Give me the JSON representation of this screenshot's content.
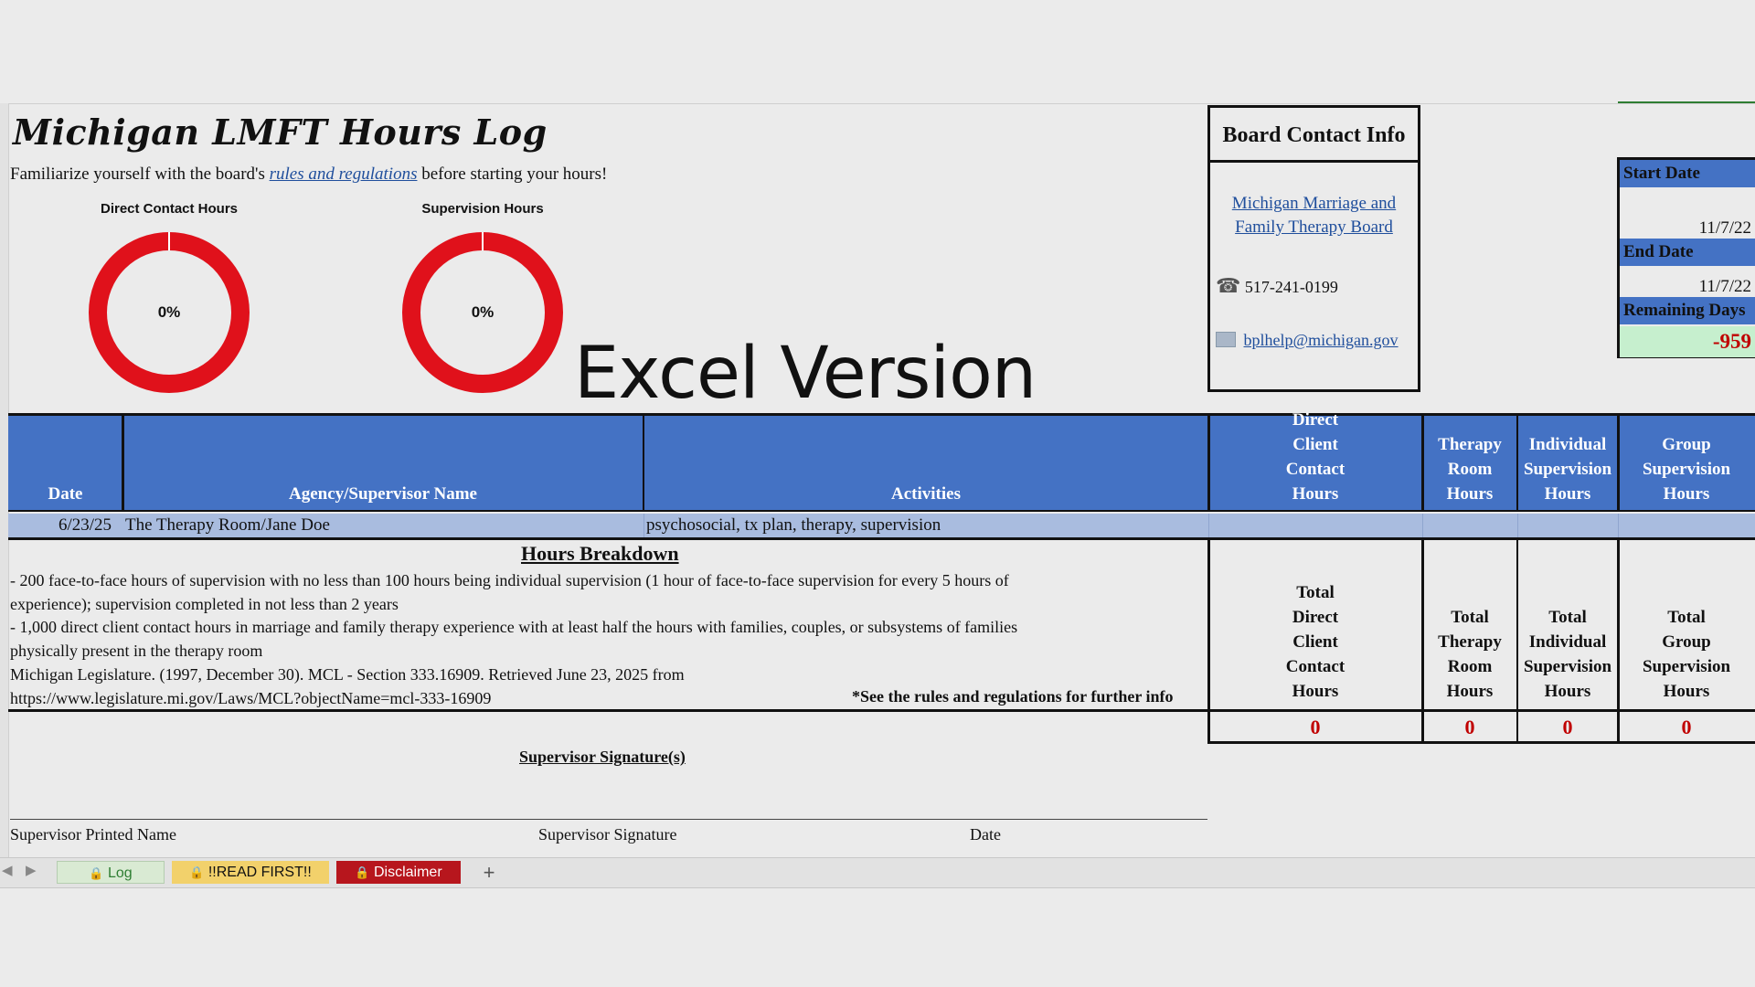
{
  "header": {
    "title": "Michigan LMFT Hours Log",
    "intro_before": "Familiarize yourself with the board's ",
    "intro_link": "rules and regulations",
    "intro_after": " before starting your hours!"
  },
  "charts": {
    "direct_label": "Direct Contact Hours",
    "direct_pct": "0%",
    "direct_value": 0,
    "supervision_label": "Supervision Hours",
    "supervision_pct": "0%",
    "supervision_value": 0,
    "ring_color": "#e0111b"
  },
  "overlay_text": "Excel Version",
  "contact": {
    "heading": "Board Contact Info",
    "board_link_line1": "Michigan Marriage and",
    "board_link_line2": "Family Therapy Board",
    "phone": "517-241-0199",
    "email": "bplhelp@michigan.gov"
  },
  "dates": {
    "start_label": "Start Date",
    "start_value": "11/7/22",
    "end_label": "End Date",
    "end_value": "11/7/22",
    "remaining_label": "Remaining Days",
    "remaining_value": "-959"
  },
  "table": {
    "headers": {
      "date": "Date",
      "agency": "Agency/Supervisor Name",
      "activities": "Activities",
      "direct": [
        "Direct",
        "Client",
        "Contact",
        "Hours"
      ],
      "therapy_room": [
        "Therapy",
        "Room",
        "Hours"
      ],
      "individual": [
        "Individual",
        "Supervision",
        "Hours"
      ],
      "group": [
        "Group",
        "Supervision",
        "Hours"
      ]
    },
    "rows": [
      {
        "date": "6/23/25",
        "agency": "The Therapy Room/Jane Doe",
        "activities": "psychosocial, tx plan, therapy, supervision",
        "direct": "",
        "therapy_room": "",
        "individual": "",
        "group": ""
      }
    ]
  },
  "breakdown": {
    "title": "Hours Breakdown",
    "line1": "- 200 face-to-face hours of supervision with no less than 100 hours being individual supervision (1 hour of face-to-face supervision for every 5 hours of",
    "line2": "experience); supervision completed in not less than 2 years",
    "line3": "- 1,000 direct client contact hours in marriage and family therapy experience with at least half the hours with families, couples, or subsystems of families",
    "line4": "physically present in the therapy room",
    "line5": "Michigan Legislature. (1997, December 30). MCL - Section 333.16909. Retrieved June 23, 2025 from",
    "line6": "https://www.legislature.mi.gov/Laws/MCL?objectName=mcl-333-16909",
    "see_note": "*See the rules and regulations for further info"
  },
  "totals": {
    "direct_label": [
      "Total",
      "Direct",
      "Client",
      "Contact",
      "Hours"
    ],
    "therapy_label": [
      "Total",
      "Therapy",
      "Room",
      "Hours"
    ],
    "individual_label": [
      "Total",
      "Individual",
      "Supervision",
      "Hours"
    ],
    "group_label": [
      "Total",
      "Group",
      "Supervision",
      "Hours"
    ],
    "direct_value": "0",
    "therapy_value": "0",
    "individual_value": "0",
    "group_value": "0"
  },
  "signature": {
    "title": "Supervisor Signature(s)",
    "printed_name": "Supervisor Printed Name",
    "signature": "Supervisor Signature",
    "date": "Date"
  },
  "tabs": [
    {
      "label": "Log",
      "bg": "#d9ead3",
      "color": "#2e7d32"
    },
    {
      "label": "!!READ FIRST!!",
      "bg": "#f2d16b",
      "color": "#111111"
    },
    {
      "label": "Disclaimer",
      "bg": "#b7161d",
      "color": "#ffffff"
    }
  ],
  "add_sheet": "+"
}
